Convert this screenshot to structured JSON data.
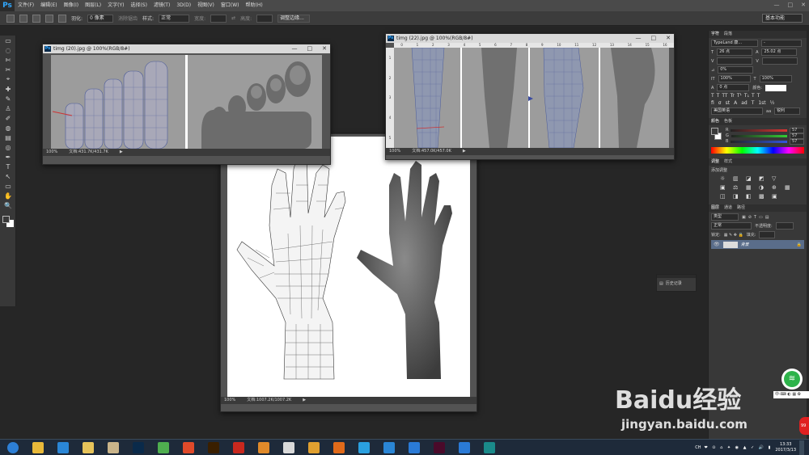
{
  "app": {
    "logo": "Ps"
  },
  "menu": [
    "文件(F)",
    "编辑(E)",
    "图像(I)",
    "图层(L)",
    "文字(Y)",
    "选择(S)",
    "滤镜(T)",
    "3D(D)",
    "视图(V)",
    "窗口(W)",
    "帮助(H)"
  ],
  "window_controls": [
    "—",
    "□",
    "✕"
  ],
  "options": {
    "feather_label": "羽化:",
    "feather_value": "0 像素",
    "antialias_label": "消除锯齿",
    "style_label": "样式:",
    "style_value": "正常",
    "width_label": "宽度:",
    "height_label": "高度:",
    "refine_edge": "调整边缘...",
    "workspace": "基本功能"
  },
  "tools": [
    "▭",
    "◌",
    "✄",
    "✂",
    "⌖",
    "✚",
    "✎",
    "♙",
    "✐",
    "◍",
    "▤",
    "◎",
    "✒",
    "T",
    "↖",
    "▭",
    "✋",
    "🔍"
  ],
  "doc_feet": {
    "title": "timg (20).jpg @ 100%(RGB/8#)",
    "zoom": "100%",
    "docinfo": "文档:431.7K/431.7K"
  },
  "doc_legs": {
    "title": "timg (22).jpg @ 100%(RGB/8#)",
    "zoom": "100%",
    "docinfo": "文档:457.0K/457.0K",
    "ruler": [
      "0",
      "1",
      "2",
      "3",
      "4",
      "5",
      "6",
      "7",
      "8",
      "9",
      "10",
      "11",
      "12",
      "13",
      "14",
      "15",
      "16"
    ]
  },
  "doc_hand": {
    "zoom": "100%",
    "docinfo": "文档:1007.2K/1007.2K"
  },
  "char_panel": {
    "tabs": [
      "字符",
      "段落"
    ],
    "font_family": "TypeLand 康...",
    "font_style": "-",
    "size": "26 点",
    "leading": "25.02 点",
    "scale_pct": "0%",
    "vscale": "100%",
    "hscale": "100%",
    "baseline": "0 点",
    "color_label": "颜色:",
    "lang": "美国英语",
    "aa": "锐利"
  },
  "color_panel": {
    "tabs": [
      "颜色",
      "色板"
    ],
    "channels": [
      {
        "label": "R",
        "value": "57"
      },
      {
        "label": "G",
        "value": "57"
      },
      {
        "label": "B",
        "value": "57"
      }
    ]
  },
  "adjust_panel": {
    "tabs": [
      "调整",
      "样式"
    ],
    "title": "添加调整"
  },
  "layers_panel": {
    "tabs": [
      "图层",
      "通道",
      "路径"
    ],
    "kind": "类型",
    "blend": "正常",
    "opacity_label": "不透明度:",
    "lock_label": "锁定:",
    "fill_label": "填充:",
    "layer_name": "背景"
  },
  "history_panel": {
    "label": "历史记录"
  },
  "taskbar": {
    "apps": [
      {
        "icon": "windows-start-icon",
        "color": "#2d7fd6"
      },
      {
        "icon": "chrome-like-icon",
        "color": "#e8b93a"
      },
      {
        "icon": "ie-icon",
        "color": "#2a86d6"
      },
      {
        "icon": "explorer-icon",
        "color": "#e6c35a"
      },
      {
        "icon": "media-icon",
        "color": "#c9b48a"
      },
      {
        "icon": "photoshop-icon",
        "color": "#0a2a4a"
      },
      {
        "icon": "refresh-icon",
        "color": "#4fae4f"
      },
      {
        "icon": "360-icon",
        "color": "#e04a2a"
      },
      {
        "icon": "illustrator-icon",
        "color": "#3a1f00"
      },
      {
        "icon": "pdf-icon",
        "color": "#c8281e"
      },
      {
        "icon": "box-icon",
        "color": "#e08a2a"
      },
      {
        "icon": "penguin-icon",
        "color": "#d9d9d9"
      },
      {
        "icon": "chrome-icon",
        "color": "#e0a030"
      },
      {
        "icon": "firefox-icon",
        "color": "#e06a1a"
      },
      {
        "icon": "w-icon",
        "color": "#2aa0e0"
      },
      {
        "icon": "plane-icon",
        "color": "#2a86d6"
      },
      {
        "icon": "s-icon",
        "color": "#2a7ad6"
      },
      {
        "icon": "indesign-icon",
        "color": "#4a0a2a"
      },
      {
        "icon": "bird-icon",
        "color": "#2a7ad6"
      },
      {
        "icon": "maya-icon",
        "color": "#1a8a8a"
      }
    ],
    "lang": "CH",
    "time": "13:33",
    "date": "2017/3/13"
  },
  "watermark": {
    "brand": "Baidu经验",
    "url": "jingyan.baidu.com"
  }
}
